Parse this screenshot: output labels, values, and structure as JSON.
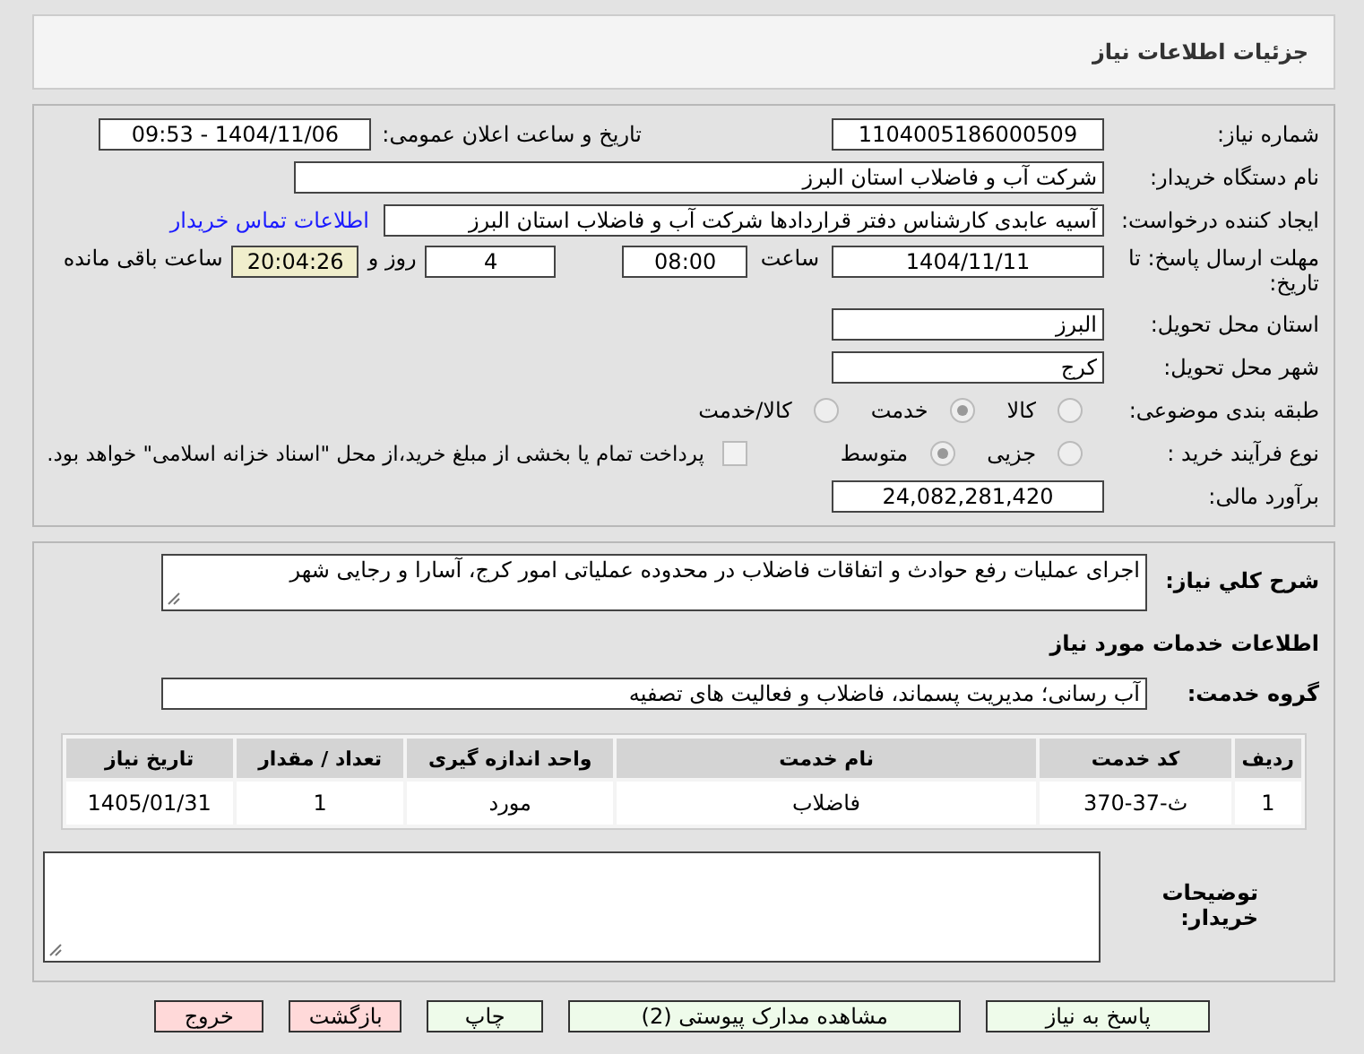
{
  "header": {
    "title": "جزئیات اطلاعات نیاز"
  },
  "fields": {
    "need_number": {
      "label": "شماره نیاز:",
      "value": "1104005186000509"
    },
    "announce": {
      "label": "تاریخ و ساعت اعلان عمومی:",
      "value": "1404/11/06 - 09:53"
    },
    "buyer": {
      "label": "نام دستگاه خریدار:",
      "value": "شرکت آب و فاضلاب استان البرز"
    },
    "creator": {
      "label": "ایجاد کننده درخواست:",
      "value": "آسیه عابدی کارشناس دفتر قراردادها شرکت آب و فاضلاب استان البرز",
      "link": "اطلاعات تماس خریدار"
    },
    "deadline": {
      "label": "مهلت ارسال پاسخ: تا تاریخ:",
      "date": "1404/11/11",
      "time_label": "ساعت",
      "time": "08:00",
      "days": "4",
      "days_label": "روز و",
      "remaining": "20:04:26",
      "remaining_label": "ساعت باقی مانده"
    },
    "province": {
      "label": "استان محل تحویل:",
      "value": "البرز"
    },
    "city": {
      "label": "شهر محل تحویل:",
      "value": "کرج"
    },
    "category": {
      "label": "طبقه بندی موضوعی:",
      "options": [
        {
          "label": "کالا",
          "selected": false
        },
        {
          "label": "خدمت",
          "selected": true
        },
        {
          "label": "کالا/خدمت",
          "selected": false
        }
      ]
    },
    "process": {
      "label": "نوع فرآیند خرید :",
      "options": [
        {
          "label": "جزیی",
          "selected": false
        },
        {
          "label": "متوسط",
          "selected": true
        }
      ],
      "treasury": {
        "checked": false,
        "label": "پرداخت تمام یا بخشی از مبلغ خرید،از محل \"اسناد خزانه اسلامی\" خواهد بود."
      }
    },
    "budget": {
      "label": "برآورد مالی:",
      "value": "24,082,281,420"
    }
  },
  "description": {
    "label": "شرح كلي نياز:",
    "value": "اجرای عملیات رفع حوادث و اتفاقات فاضلاب در محدوده عملیاتی امور کرج، آسارا و رجایی شهر"
  },
  "services_title": "اطلاعات خدمات مورد نیاز",
  "service_group": {
    "label": "گروه خدمت:",
    "value": "آب رسانی؛ مدیریت پسماند، فاضلاب و فعالیت های تصفیه"
  },
  "table": {
    "columns": [
      "ردیف",
      "کد خدمت",
      "نام خدمت",
      "واحد اندازه گیری",
      "تعداد / مقدار",
      "تاریخ نیاز"
    ],
    "rows": [
      [
        "1",
        "ث-37-370",
        "فاضلاب",
        "مورد",
        "1",
        "1405/01/31"
      ]
    ]
  },
  "buyer_notes": {
    "label": "توضیحات خریدار:"
  },
  "buttons": [
    {
      "label": "پاسخ به نیاز",
      "kind": "green"
    },
    {
      "label": "مشاهده مدارک پیوستی (2)",
      "kind": "green"
    },
    {
      "label": "چاپ",
      "kind": "green"
    },
    {
      "label": "بازگشت",
      "kind": "red"
    },
    {
      "label": "خروج",
      "kind": "red"
    }
  ]
}
